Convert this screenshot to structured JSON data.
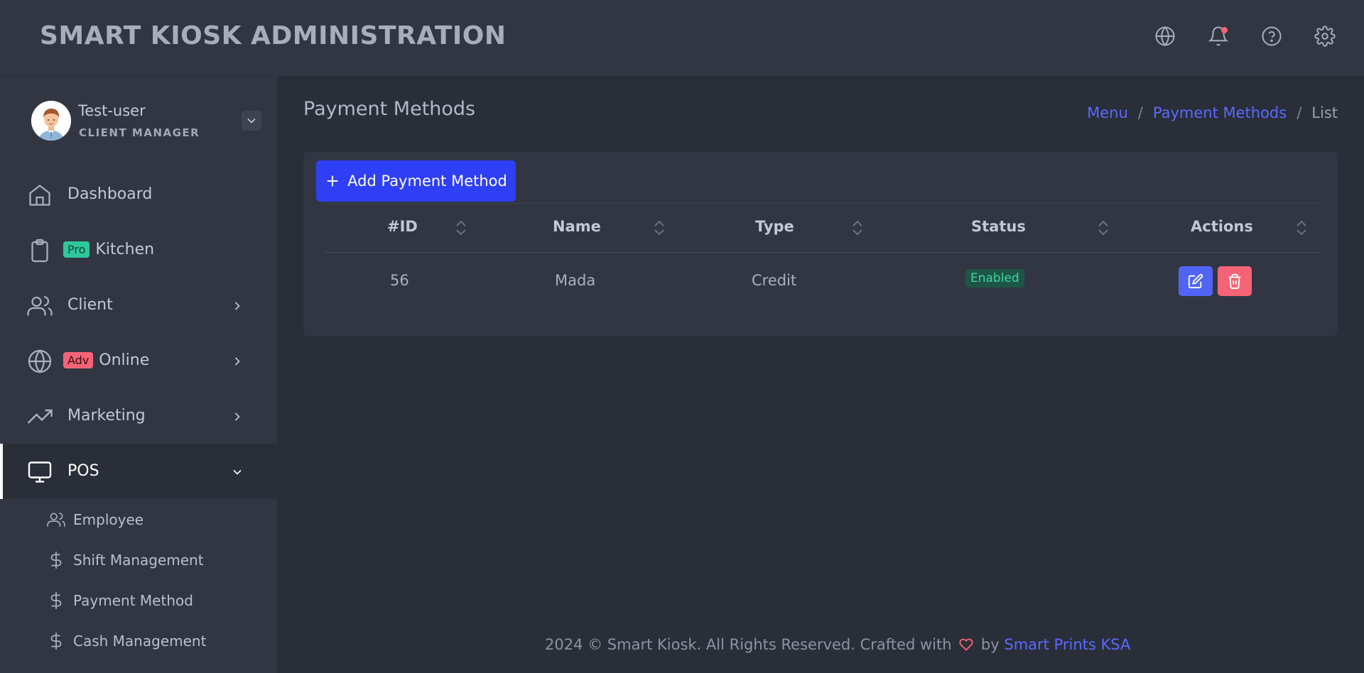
{
  "app": {
    "brand": "SMART KIOSK ADMINISTRATION"
  },
  "topbar": {
    "icons": [
      "globe-icon",
      "bell-icon",
      "help-icon",
      "gear-icon"
    ]
  },
  "user": {
    "name": "Test-user",
    "role": "CLIENT MANAGER"
  },
  "sidebar": {
    "items": [
      {
        "label": "Dashboard",
        "icon": "home-icon"
      },
      {
        "label": "Kitchen",
        "icon": "clipboard-icon",
        "badge": "Pro"
      },
      {
        "label": "Client",
        "icon": "users-icon"
      },
      {
        "label": "Online",
        "icon": "globe-icon",
        "badge": "Adv"
      },
      {
        "label": "Marketing",
        "icon": "trending-up-icon"
      },
      {
        "label": "POS",
        "icon": "monitor-icon"
      }
    ],
    "sub_items": [
      {
        "label": "Employee",
        "icon": "users-icon"
      },
      {
        "label": "Shift Management",
        "icon": "dollar-icon"
      },
      {
        "label": "Payment Method",
        "icon": "dollar-icon"
      },
      {
        "label": "Cash Management",
        "icon": "dollar-icon"
      }
    ]
  },
  "page": {
    "title": "Payment Methods",
    "breadcrumb": {
      "menu": "Menu",
      "section": "Payment Methods",
      "current": "List",
      "separator": "/"
    }
  },
  "toolbar": {
    "add_label": "Add Payment Method"
  },
  "table": {
    "columns": [
      "#ID",
      "Name",
      "Type",
      "Status",
      "Actions"
    ],
    "rows": [
      {
        "id": "56",
        "name": "Mada",
        "type": "Credit",
        "status": "Enabled"
      }
    ]
  },
  "footer": {
    "text": "2024 © Smart Kiosk. All Rights Reserved. Crafted with",
    "by": "by",
    "link": "Smart Prints KSA"
  },
  "colors": {
    "accent": "#2f3ff5",
    "link": "#5a6aff",
    "success": "#3ed6a0",
    "danger": "#f56476",
    "edit": "#5065f6"
  }
}
